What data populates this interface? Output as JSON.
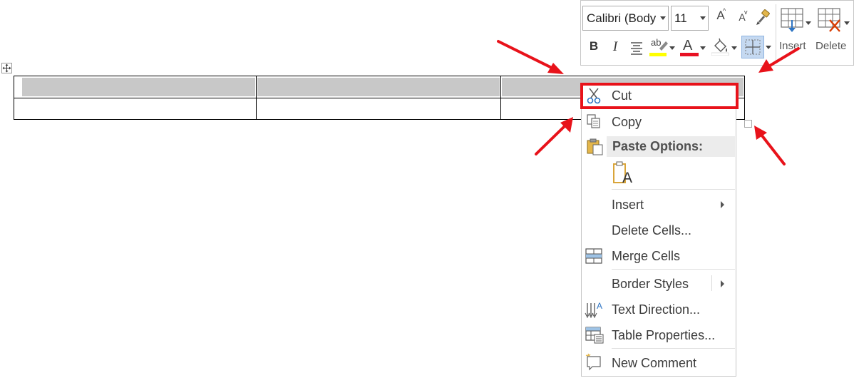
{
  "toolbar": {
    "font_name": "Calibri (Body",
    "font_size": "11",
    "grow_font_glyph": "A",
    "shrink_font_glyph": "A",
    "bold": "B",
    "italic": "I",
    "highlight_glyph": "ab",
    "font_color_glyph": "A",
    "insert_label": "Insert",
    "delete_label": "Delete",
    "highlight_color": "#ffff00",
    "font_color": "#e81123"
  },
  "context_menu": {
    "cut": "Cut",
    "copy": "Copy",
    "paste_options": "Paste Options:",
    "paste_keep_text_glyph": "A",
    "insert": "Insert",
    "delete_cells": "Delete Cells...",
    "merge_cells": "Merge Cells",
    "border_styles": "Border Styles",
    "text_direction": "Text Direction...",
    "table_properties": "Table Properties...",
    "new_comment": "New Comment"
  },
  "annotations": {
    "arrow_color": "#e8121a",
    "highlight_color": "#e8121a"
  }
}
